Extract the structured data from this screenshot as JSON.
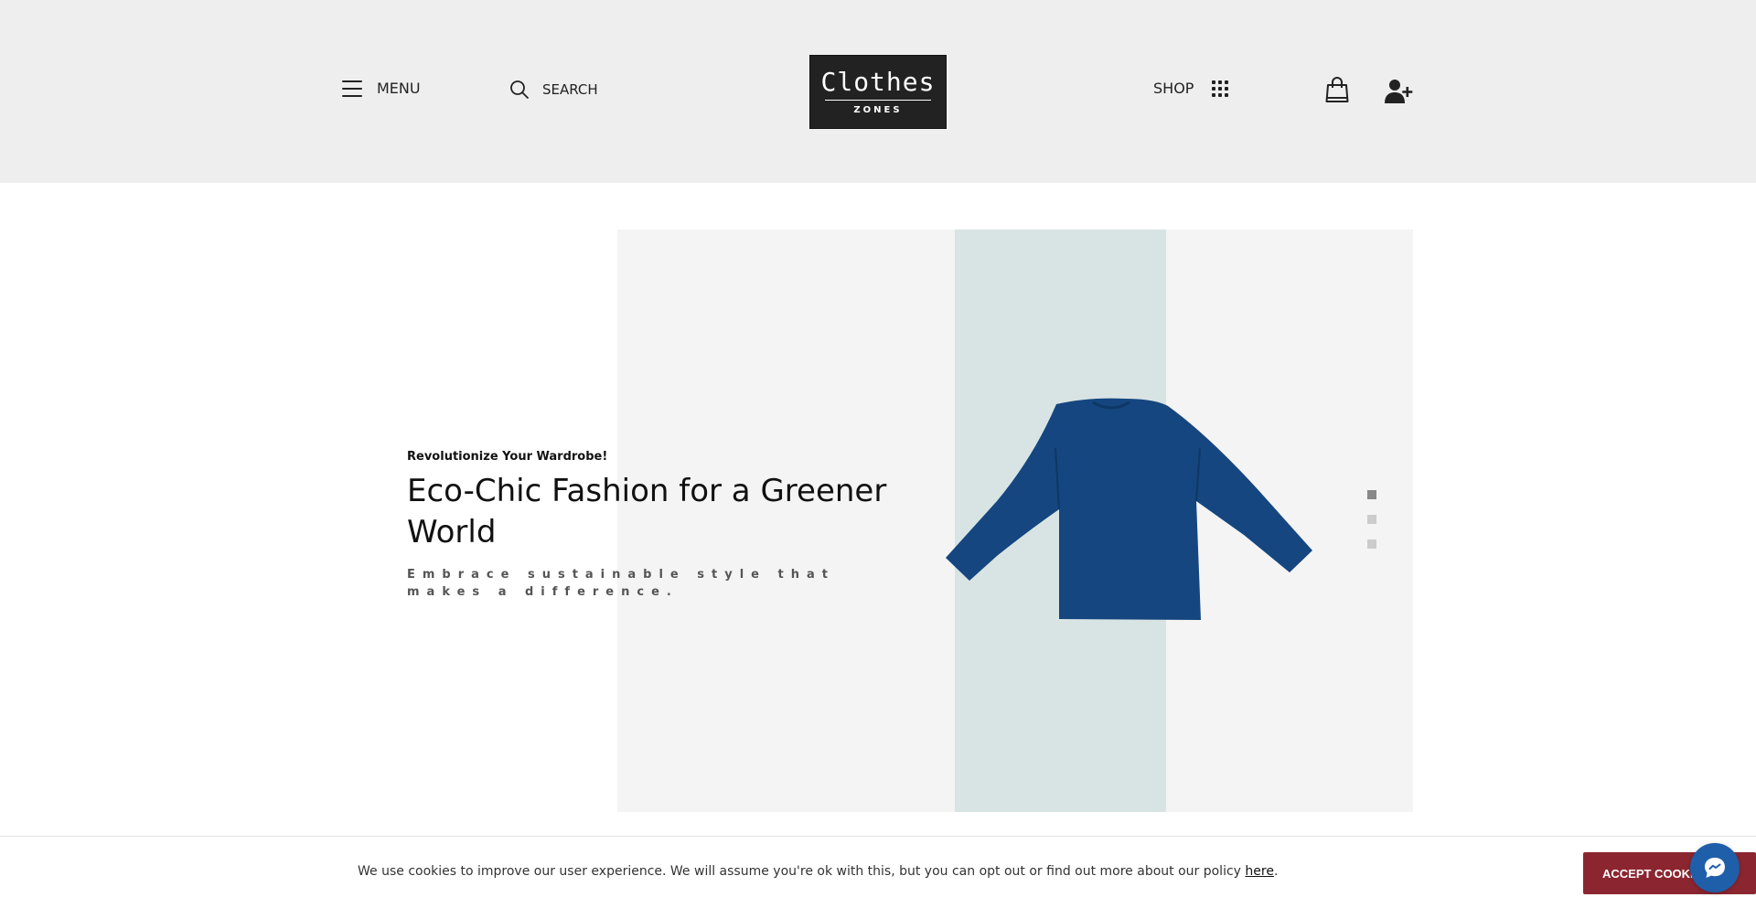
{
  "header": {
    "menu_label": "MENU",
    "menu_icon": "hamburger-icon",
    "search_label": "SEARCH",
    "search_icon": "search-icon",
    "logo": {
      "main": "Clothes",
      "sub": "ZONES"
    },
    "shop_label": "SHOP",
    "shop_icon": "grid-dots-icon",
    "cart_icon": "shopping-bag-icon",
    "account_icon": "user-plus-icon"
  },
  "hero": {
    "eyebrow": "Revolutionize Your Wardrobe!",
    "title": "Eco-Chic Fashion for a Greener World",
    "subtitle": "Embrace sustainable style that makes a difference.",
    "image_icon": "blue-sweater-image",
    "slides": {
      "count": 3,
      "active_index": 0
    }
  },
  "cookie_bar": {
    "text": "We use cookies to improve our user experience. We will assume you're ok with this, but you can opt out or find out more about our policy ",
    "link_text": "here",
    "trailing": ".",
    "accept_label": "ACCEPT COOKIES"
  },
  "chat": {
    "icon": "chat-bubble-icon"
  },
  "colors": {
    "header_bg": "#eeeeee",
    "hero_bg": "#f4f4f4",
    "hero_stripe": "#d8e4e4",
    "sweater": "#15467f",
    "accept_button": "#8b2630",
    "chat_button": "#1f5ea8"
  }
}
